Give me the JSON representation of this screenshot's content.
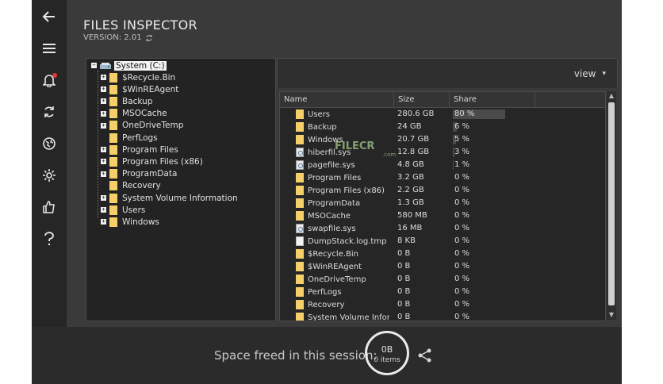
{
  "app": {
    "title": "FILES INSPECTOR",
    "version": "VERSION: 2.01"
  },
  "sidebar": {
    "items": [
      {
        "icon": "back-arrow-icon"
      },
      {
        "icon": "menu-icon"
      },
      {
        "icon": "bell-icon"
      },
      {
        "icon": "refresh-icon"
      },
      {
        "icon": "globe-icon"
      },
      {
        "icon": "gear-icon"
      },
      {
        "icon": "thumbs-up-icon"
      },
      {
        "icon": "help-icon"
      }
    ]
  },
  "tree": {
    "root": "System (C:)",
    "items": [
      {
        "label": "$Recycle.Bin",
        "expandable": true
      },
      {
        "label": "$WinREAgent",
        "expandable": true
      },
      {
        "label": "Backup",
        "expandable": true
      },
      {
        "label": "MSOCache",
        "expandable": true
      },
      {
        "label": "OneDriveTemp",
        "expandable": true
      },
      {
        "label": "PerfLogs",
        "expandable": false
      },
      {
        "label": "Program Files",
        "expandable": true
      },
      {
        "label": "Program Files (x86)",
        "expandable": true
      },
      {
        "label": "ProgramData",
        "expandable": true
      },
      {
        "label": "Recovery",
        "expandable": false
      },
      {
        "label": "System Volume Information",
        "expandable": true
      },
      {
        "label": "Users",
        "expandable": true
      },
      {
        "label": "Windows",
        "expandable": true
      }
    ]
  },
  "view": {
    "label": "view",
    "arrow": "▾"
  },
  "table": {
    "columns": [
      "Name",
      "Size",
      "Share"
    ],
    "rows": [
      {
        "name": "Users",
        "size": "280.6 GB",
        "share": "80 %",
        "share_value": 80,
        "icon": "folder"
      },
      {
        "name": "Backup",
        "size": "24 GB",
        "share": "6 %",
        "share_value": 6,
        "icon": "folder"
      },
      {
        "name": "Windows",
        "size": "20.7 GB",
        "share": "5 %",
        "share_value": 5,
        "icon": "folder"
      },
      {
        "name": "hiberfil.sys",
        "size": "12.8 GB",
        "share": "3 %",
        "share_value": 3,
        "icon": "system-file"
      },
      {
        "name": "pagefile.sys",
        "size": "4.8 GB",
        "share": "1 %",
        "share_value": 1,
        "icon": "system-file"
      },
      {
        "name": "Program Files",
        "size": "3.2 GB",
        "share": "0 %",
        "share_value": 0,
        "icon": "folder"
      },
      {
        "name": "Program Files (x86)",
        "size": "2.2 GB",
        "share": "0 %",
        "share_value": 0,
        "icon": "folder"
      },
      {
        "name": "ProgramData",
        "size": "1.3 GB",
        "share": "0 %",
        "share_value": 0,
        "icon": "folder"
      },
      {
        "name": "MSOCache",
        "size": "580 MB",
        "share": "0 %",
        "share_value": 0,
        "icon": "folder"
      },
      {
        "name": "swapfile.sys",
        "size": "16 MB",
        "share": "0 %",
        "share_value": 0,
        "icon": "system-file"
      },
      {
        "name": "DumpStack.log.tmp",
        "size": "8 KB",
        "share": "0 %",
        "share_value": 0,
        "icon": "file"
      },
      {
        "name": "$Recycle.Bin",
        "size": "0 B",
        "share": "0 %",
        "share_value": 0,
        "icon": "folder"
      },
      {
        "name": "$WinREAgent",
        "size": "0 B",
        "share": "0 %",
        "share_value": 0,
        "icon": "folder"
      },
      {
        "name": "OneDriveTemp",
        "size": "0 B",
        "share": "0 %",
        "share_value": 0,
        "icon": "folder"
      },
      {
        "name": "PerfLogs",
        "size": "0 B",
        "share": "0 %",
        "share_value": 0,
        "icon": "folder"
      },
      {
        "name": "Recovery",
        "size": "0 B",
        "share": "0 %",
        "share_value": 0,
        "icon": "folder"
      },
      {
        "name": "System Volume Infor...",
        "size": "0 B",
        "share": "0 %",
        "share_value": 0,
        "icon": "folder"
      }
    ]
  },
  "watermark": {
    "text": "FILECR",
    "sub": ".com"
  },
  "footer": {
    "label": "Space freed in this session:",
    "freed_value": "0B",
    "items_count": "0 items"
  },
  "colors": {
    "background": "#3a3a3a",
    "sidebar": "#262626",
    "folder": "#f4cf6a",
    "notification": "#e5383b"
  }
}
